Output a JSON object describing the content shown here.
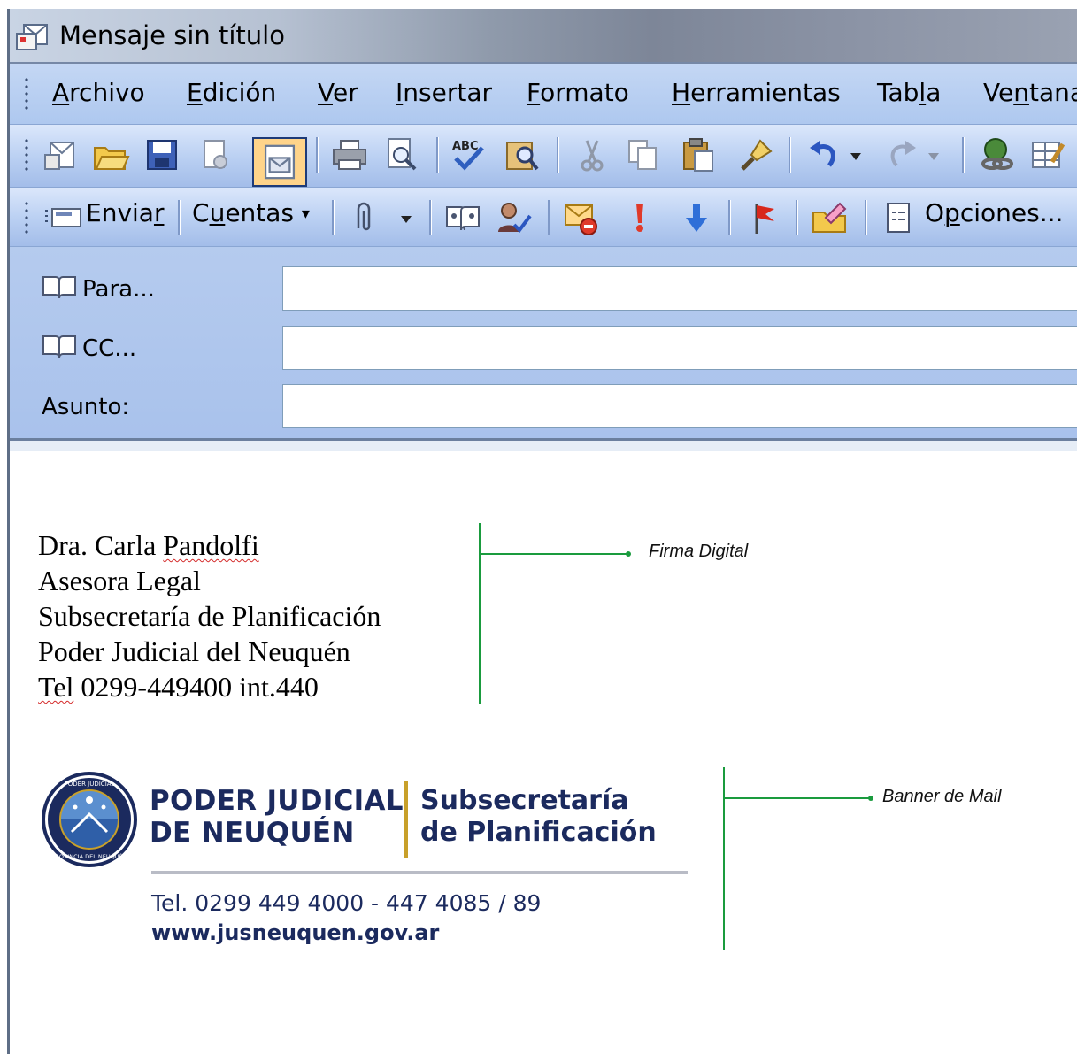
{
  "window": {
    "title": "Mensaje sin título"
  },
  "menu": [
    {
      "label": "Archivo",
      "key": "A"
    },
    {
      "label": "Edición",
      "key": "E"
    },
    {
      "label": "Ver",
      "key": "V"
    },
    {
      "label": "Insertar",
      "key": "I"
    },
    {
      "label": "Formato",
      "key": "F"
    },
    {
      "label": "Herramientas",
      "key": "H"
    },
    {
      "label": "Tabla",
      "key": "l"
    },
    {
      "label": "Ventana",
      "key": "n"
    }
  ],
  "toolbar_standard": {
    "icons": [
      "new-icon",
      "open-folder-icon",
      "save-icon",
      "permission-icon",
      "mail-message-icon",
      "print-icon",
      "print-preview-icon",
      "spelling-icon",
      "research-icon",
      "cut-icon",
      "copy-icon",
      "paste-icon",
      "format-painter-icon",
      "undo-icon",
      "redo-icon",
      "hyperlink-icon",
      "table-icon"
    ]
  },
  "toolbar_email": {
    "send_label": "Enviar",
    "accounts_label": "Cuentas",
    "options_label": "Opciones...",
    "icons": [
      "attach-icon",
      "address-book-icon",
      "check-names-icon",
      "message-flag-icon",
      "high-importance-icon",
      "low-importance-icon",
      "follow-up-flag-icon",
      "permission-folder-icon",
      "options-icon"
    ]
  },
  "header": {
    "to_label": "Para...",
    "cc_label": "CC...",
    "subject_label": "Asunto:",
    "to_value": "",
    "cc_value": "",
    "subject_value": ""
  },
  "signature": {
    "lines": [
      "Dra. Carla Pandolfi",
      "Asesora Legal",
      "Subsecretaría de Planificación",
      "Poder Judicial del Neuquén",
      "Tel 0299-449400 int.440"
    ]
  },
  "annotations": {
    "signature_label": "Firma Digital",
    "banner_label": "Banner de Mail",
    "color": "#1a9b3e"
  },
  "banner": {
    "org_line1": "PODER JUDICIAL",
    "org_line2": "DE NEUQUÉN",
    "unit_line1": "Subsecretaría",
    "unit_line2": "de Planificación",
    "tel": "Tel. 0299 449 4000 - 447 4085 / 89",
    "web": "www.jusneuquen.gov.ar",
    "seal_text": "PODER JUDICIAL · PROVINCIA DEL NEUQUÉN",
    "colors": {
      "navy": "#1b2a5e",
      "gold": "#c8a02a",
      "rule": "#b9bcc6"
    }
  }
}
